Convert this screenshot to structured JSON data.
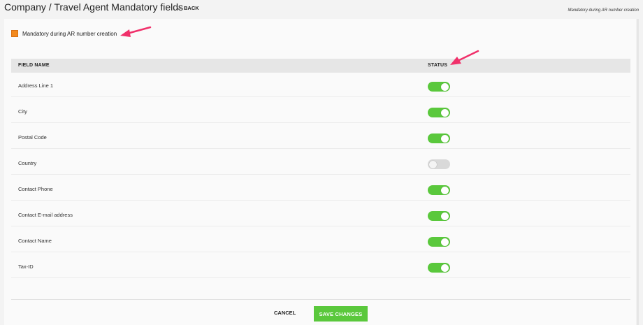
{
  "header": {
    "title": "Company / Travel Agent Mandatory fields",
    "back_label": "BACK",
    "note": "Mandatory during AR number creation"
  },
  "legend": {
    "label": "Mandatory during AR number creation",
    "color": "#f2891d"
  },
  "table": {
    "columns": [
      "FIELD NAME",
      "STATUS"
    ],
    "rows": [
      {
        "field": "Address Line 1",
        "enabled": true
      },
      {
        "field": "City",
        "enabled": true
      },
      {
        "field": "Postal Code",
        "enabled": true
      },
      {
        "field": "Country",
        "enabled": false
      },
      {
        "field": "Contact Phone",
        "enabled": true
      },
      {
        "field": "Contact E-mail address",
        "enabled": true
      },
      {
        "field": "Contact Name",
        "enabled": true
      },
      {
        "field": "Tax-ID",
        "enabled": true
      }
    ]
  },
  "footer": {
    "cancel_label": "CANCEL",
    "save_label": "SAVE CHANGES"
  },
  "colors": {
    "toggle_on": "#5ac83c",
    "toggle_off": "#d9d9d9",
    "annotation_arrow": "#f0306a"
  }
}
